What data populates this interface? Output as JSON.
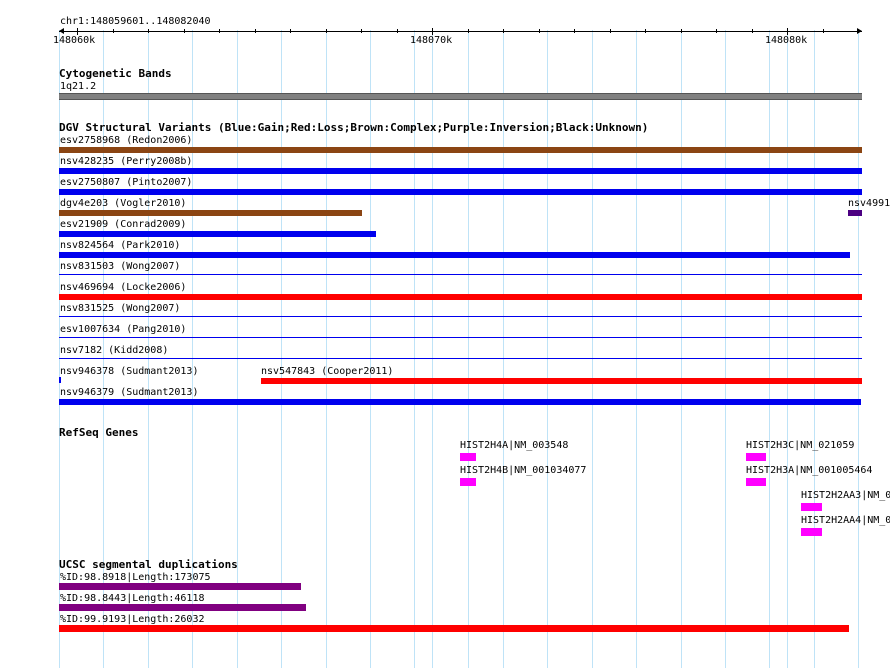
{
  "ruler": {
    "region": "chr1:148059601..148082040",
    "ticks": [
      "148060k",
      "148070k",
      "148080k"
    ]
  },
  "colors": {
    "blue": "#0000ee",
    "red": "#ff0000",
    "brown": "#8b4513",
    "purple": "#800080",
    "magenta": "#ff00ff",
    "gray": "#808080",
    "grid": "#bfe3f7"
  },
  "cytoband": {
    "title": "Cytogenetic Bands",
    "label": "1q21.2"
  },
  "dgv": {
    "title": "DGV Structural Variants (Blue:Gain;Red:Loss;Brown:Complex;Purple:Inversion;Black:Unknown)",
    "tracks": [
      {
        "label": "esv2758968 (Redon2006)",
        "color": "brown"
      },
      {
        "label": "nsv428235 (Perry2008b)",
        "color": "blue"
      },
      {
        "label": "esv2750807 (Pinto2007)",
        "color": "blue"
      },
      {
        "label": "dgv4e203 (Vogler2010)",
        "color": "brown"
      },
      {
        "label": "nsv4991",
        "color": "purple"
      },
      {
        "label": "esv21909 (Conrad2009)",
        "color": "blue"
      },
      {
        "label": "nsv824564 (Park2010)",
        "color": "blue"
      },
      {
        "label": "nsv831503 (Wong2007)",
        "color": "blue"
      },
      {
        "label": "nsv469694 (Locke2006)",
        "color": "red"
      },
      {
        "label": "nsv831525 (Wong2007)",
        "color": "blue"
      },
      {
        "label": "esv1007634 (Pang2010)",
        "color": "blue"
      },
      {
        "label": "nsv7182 (Kidd2008)",
        "color": "blue"
      },
      {
        "label": "nsv946378 (Sudmant2013)",
        "color": "blue"
      },
      {
        "label": "nsv547843 (Cooper2011)",
        "color": "red"
      },
      {
        "label": "nsv946379 (Sudmant2013)",
        "color": "blue"
      }
    ]
  },
  "refseq": {
    "title": "RefSeq Genes",
    "genes": [
      {
        "label": "HIST2H4A|NM_003548"
      },
      {
        "label": "HIST2H4B|NM_001034077"
      },
      {
        "label": "HIST2H3C|NM_021059"
      },
      {
        "label": "HIST2H3A|NM_001005464"
      },
      {
        "label": "HIST2H2AA3|NM_0"
      },
      {
        "label": "HIST2H2AA4|NM_0"
      }
    ]
  },
  "segdup": {
    "title": "UCSC segmental duplications",
    "items": [
      {
        "label": "%ID:98.8918|Length:173075",
        "color": "purple"
      },
      {
        "label": "%ID:98.8443|Length:46118",
        "color": "purple"
      },
      {
        "label": "%ID:99.9193|Length:26032",
        "color": "red"
      }
    ]
  }
}
